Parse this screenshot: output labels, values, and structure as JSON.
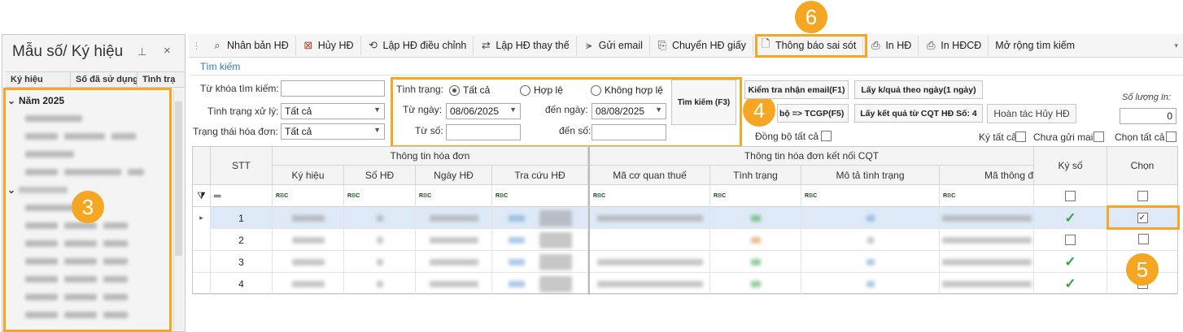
{
  "left_panel": {
    "title": "Mẫu số/ Ký hiệu",
    "pin_icon": "📌",
    "close_icon": "×",
    "columns": [
      "Ký hiệu",
      "Số đã sử dụng",
      "Tình trạ"
    ],
    "group_label": "Năm 2025"
  },
  "toolbar": {
    "items": [
      {
        "label": "Nhân bản HĐ",
        "icon": "search-icon"
      },
      {
        "label": "Hủy HĐ",
        "icon": "cancel-doc-icon"
      },
      {
        "label": "Lập HĐ điều chỉnh",
        "icon": "adjust-doc-icon"
      },
      {
        "label": "Lập HĐ thay thế",
        "icon": "replace-doc-icon"
      },
      {
        "label": "Gửi email",
        "icon": "send-icon"
      },
      {
        "label": "Chuyển HĐ giấy",
        "icon": "convert-icon"
      },
      {
        "label": "Thông báo sai sót",
        "icon": "notice-doc-icon"
      },
      {
        "label": "In HĐ",
        "icon": "printer-icon"
      },
      {
        "label": "In HĐCĐ",
        "icon": "printer-icon"
      },
      {
        "label": "Mở rộng tìm kiếm",
        "icon": ""
      }
    ]
  },
  "search": {
    "section_title": "Tìm kiếm",
    "keyword_label": "Từ khóa tìm kiếm:",
    "keyword_value": "",
    "process_label": "Tình trạng xử lý:",
    "process_value": "Tất cả",
    "invoice_status_label": "Trạng thái hóa đơn:",
    "invoice_status_value": "Tất cả",
    "status_label": "Tình trạng:",
    "radios": [
      "Tất cả",
      "Hợp lệ",
      "Không hợp lệ"
    ],
    "from_date_label": "Từ ngày:",
    "from_date": "08/06/2025",
    "to_date_label": "đến ngày:",
    "to_date": "08/08/2025",
    "from_no_label": "Từ số:",
    "from_no": "",
    "to_no_label": "đến số:",
    "to_no": "",
    "search_button": "Tìm kiếm (F3)"
  },
  "actions": {
    "check_email": "Kiểm tra nhận email(F1)",
    "sync_tcgp": "Đồng bộ => TCGP(F5)",
    "sync_tcgp_visible": "bộ => TCGP(F5)",
    "get_result_day": "Lấy k/quả theo ngày(1 ngày)",
    "get_result_cqt": "Lấy kết quả từ CQT HĐ Số: 4",
    "undo_cancel": "Hoàn tác Hủy HĐ",
    "sync_all": "Đồng bộ tất cả",
    "qty_label": "Số lượng In:",
    "qty_value": "0",
    "sign_all": "Ký tất cả",
    "not_sent": "Chưa gửi mail",
    "select_all": "Chọn tất cả"
  },
  "grid": {
    "stt_header": "STT",
    "group_info": "Thông tin hóa đơn",
    "group_cqt": "Thông tin hóa đơn kết nối CQT",
    "sign_header": "Ký số",
    "select_header": "Chọn",
    "columns": [
      "Ký hiệu",
      "Số HĐ",
      "Ngày HĐ",
      "Tra cứu HĐ",
      "Mã cơ quan thuế",
      "Tình trạng",
      "Mô tả tình trạng",
      "Mã thông đ"
    ],
    "filter_symbol": "ᴿᴮᶜ",
    "rows": [
      {
        "stt": "1",
        "signed": true,
        "selected": true
      },
      {
        "stt": "2",
        "signed": false,
        "selected": false
      },
      {
        "stt": "3",
        "signed": true,
        "selected": false
      },
      {
        "stt": "4",
        "signed": true,
        "selected": false
      }
    ]
  },
  "annotations": [
    "6",
    "3",
    "4",
    "5"
  ],
  "colors": {
    "accent": "#f5a623",
    "title_blue": "#2a7ab8",
    "row_highlight": "#dde9f6",
    "check_green": "#3aa34a"
  }
}
